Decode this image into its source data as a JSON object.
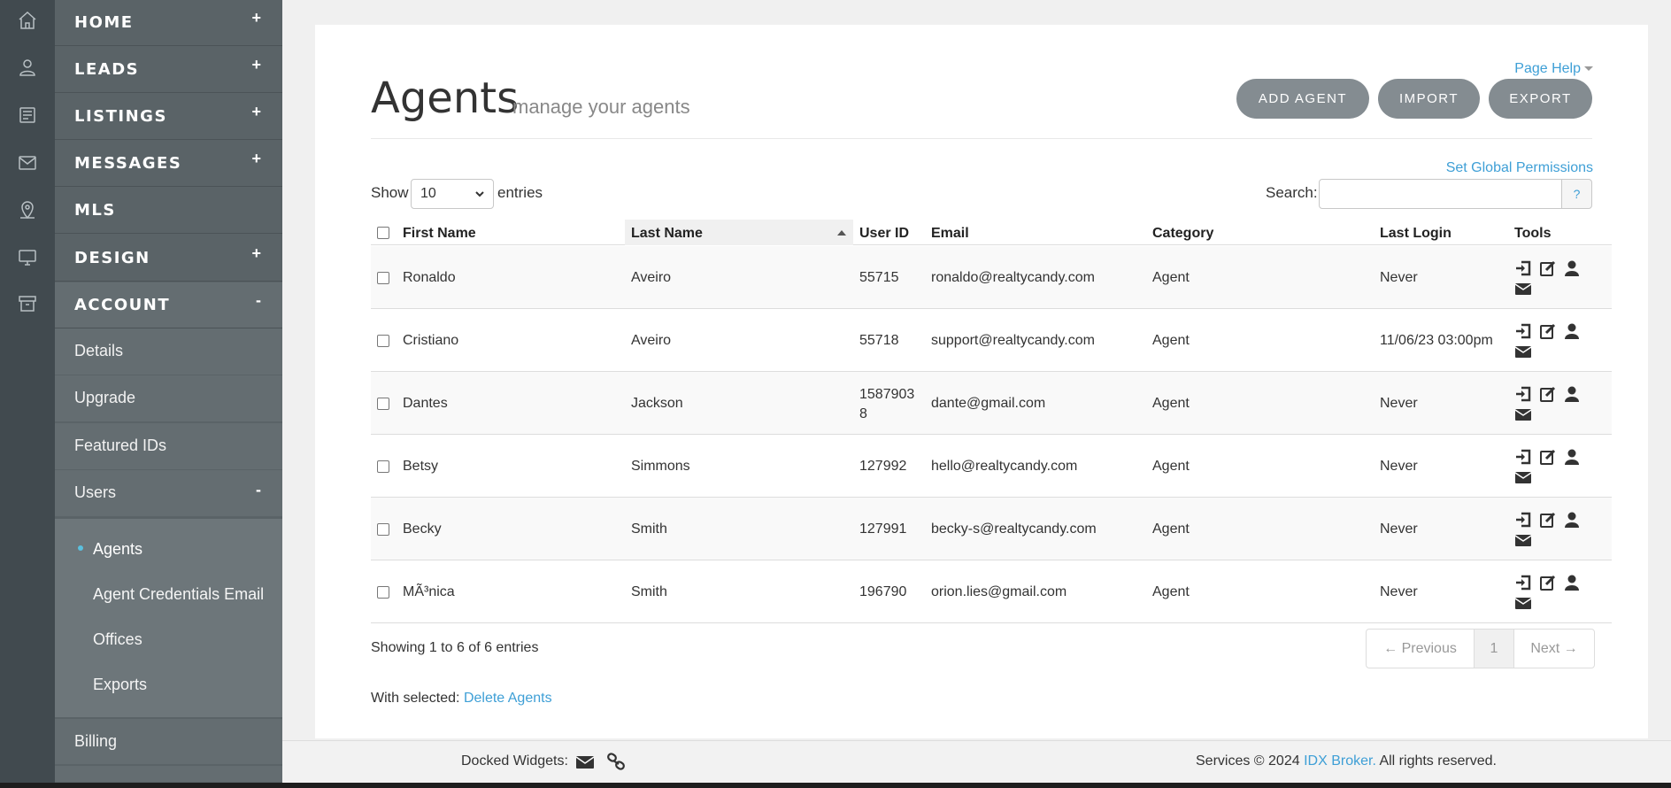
{
  "nav": {
    "main": [
      {
        "label": "HOME",
        "toggle": "+"
      },
      {
        "label": "LEADS",
        "toggle": "+"
      },
      {
        "label": "LISTINGS",
        "toggle": "+"
      },
      {
        "label": "MESSAGES",
        "toggle": "+"
      },
      {
        "label": "MLS",
        "toggle": ""
      },
      {
        "label": "DESIGN",
        "toggle": "+"
      },
      {
        "label": "ACCOUNT",
        "toggle": "-"
      }
    ],
    "account_sub": [
      {
        "label": "Details"
      },
      {
        "label": "Upgrade"
      },
      {
        "label": "Featured IDs"
      },
      {
        "label": "Users",
        "toggle": "-"
      }
    ],
    "users_sub": [
      {
        "label": "Agents"
      },
      {
        "label": "Agent Credentials Email"
      },
      {
        "label": "Offices"
      },
      {
        "label": "Exports"
      }
    ],
    "billing": "Billing"
  },
  "page": {
    "help": "Page Help",
    "title": "Agents",
    "subtitle": "manage your agents",
    "buttons": {
      "add": "ADD AGENT",
      "import": "IMPORT",
      "export": "EXPORT"
    },
    "set_permissions": "Set Global Permissions"
  },
  "table_controls": {
    "show_label": "Show",
    "page_size": "10",
    "entries_label": "entries",
    "search_label": "Search:",
    "search_value": "",
    "search_help": "?"
  },
  "table": {
    "columns": [
      "First Name",
      "Last Name",
      "User ID",
      "Email",
      "Category",
      "Last Login",
      "Tools"
    ],
    "rows": [
      {
        "first": "Ronaldo",
        "last": "Aveiro",
        "id": "55715",
        "email": "ronaldo@realtycandy.com",
        "category": "Agent",
        "login": "Never"
      },
      {
        "first": "Cristiano",
        "last": "Aveiro",
        "id": "55718",
        "email": "support@realtycandy.com",
        "category": "Agent",
        "login": "11/06/23 03:00pm"
      },
      {
        "first": "Dantes",
        "last": "Jackson",
        "id": "15879038",
        "email": "dante@gmail.com",
        "category": "Agent",
        "login": "Never"
      },
      {
        "first": "Betsy",
        "last": "Simmons",
        "id": "127992",
        "email": "hello@realtycandy.com",
        "category": "Agent",
        "login": "Never"
      },
      {
        "first": "Becky",
        "last": "Smith",
        "id": "127991",
        "email": "becky-s@realtycandy.com",
        "category": "Agent",
        "login": "Never"
      },
      {
        "first": "MÃ³nica",
        "last": "Smith",
        "id": "196790",
        "email": "orion.lies@gmail.com",
        "category": "Agent",
        "login": "Never"
      }
    ]
  },
  "footer_table": {
    "showing": "Showing 1 to 6 of 6 entries",
    "prev": "← Previous",
    "page": "1",
    "next": "Next →",
    "with_selected": "With selected:",
    "delete": "Delete Agents"
  },
  "footer": {
    "docked": "Docked Widgets:",
    "copy_prefix": "Services © 2024",
    "brand": "IDX Broker.",
    "copy_suffix": "All rights reserved."
  }
}
